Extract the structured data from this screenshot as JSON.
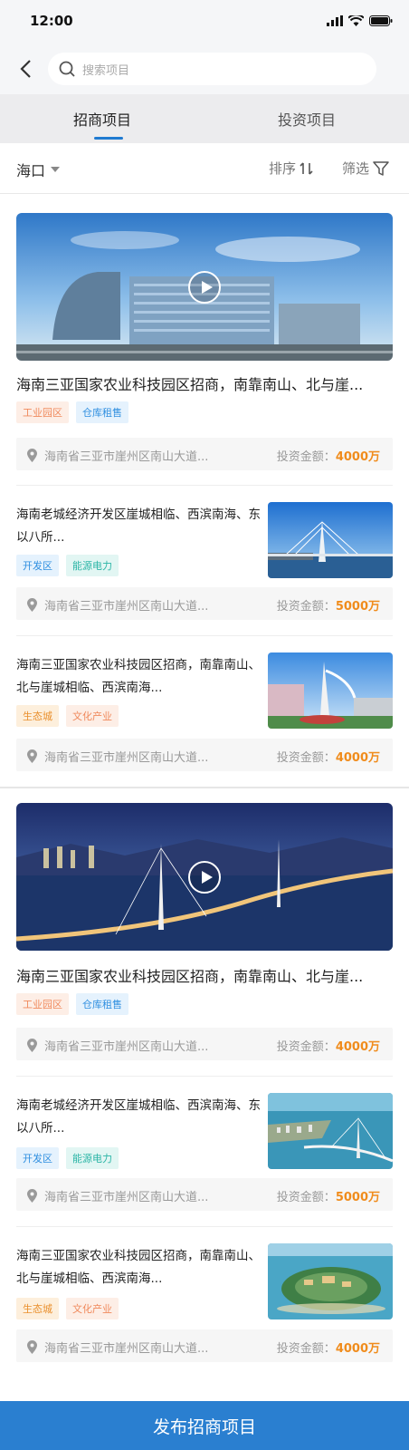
{
  "status": {
    "time": "12:00"
  },
  "search": {
    "placeholder": "搜索项目"
  },
  "tabs": [
    {
      "label": "招商项目",
      "active": true
    },
    {
      "label": "投资项目",
      "active": false
    }
  ],
  "filterbar": {
    "city": "海口",
    "sort": "排序",
    "filter": "筛选"
  },
  "colors": {
    "accent": "#1f7ad1",
    "amount": "#f08c1c",
    "publish_bg": "#2a7fd0"
  },
  "items": [
    {
      "title": "海南三亚国家农业科技园区招商，南靠南山、北与崖...",
      "tags": [
        "工业园区",
        "仓库租售"
      ],
      "location": "海南省三亚市崖州区南山大道...",
      "amount_label": "投资金额：",
      "amount": "4000万"
    },
    {
      "title": "海南老城经济开发区崖城相临、西滨南海、东以八所...",
      "tags": [
        "开发区",
        "能源电力"
      ],
      "location": "海南省三亚市崖州区南山大道...",
      "amount_label": "投资金额：",
      "amount": "5000万"
    },
    {
      "title": "海南三亚国家农业科技园区招商，南靠南山、北与崖城相临、西滨南海...",
      "tags": [
        "生态城",
        "文化产业"
      ],
      "location": "海南省三亚市崖州区南山大道...",
      "amount_label": "投资金额：",
      "amount": "4000万"
    },
    {
      "title": "海南三亚国家农业科技园区招商，南靠南山、北与崖...",
      "tags": [
        "工业园区",
        "仓库租售"
      ],
      "location": "海南省三亚市崖州区南山大道...",
      "amount_label": "投资金额：",
      "amount": "4000万"
    },
    {
      "title": "海南老城经济开发区崖城相临、西滨南海、东以八所...",
      "tags": [
        "开发区",
        "能源电力"
      ],
      "location": "海南省三亚市崖州区南山大道...",
      "amount_label": "投资金额：",
      "amount": "5000万"
    },
    {
      "title": "海南三亚国家农业科技园区招商，南靠南山、北与崖城相临、西滨南海...",
      "tags": [
        "生态城",
        "文化产业"
      ],
      "location": "海南省三亚市崖州区南山大道...",
      "amount_label": "投资金额：",
      "amount": "4000万"
    }
  ],
  "publish_button": "发布招商项目"
}
